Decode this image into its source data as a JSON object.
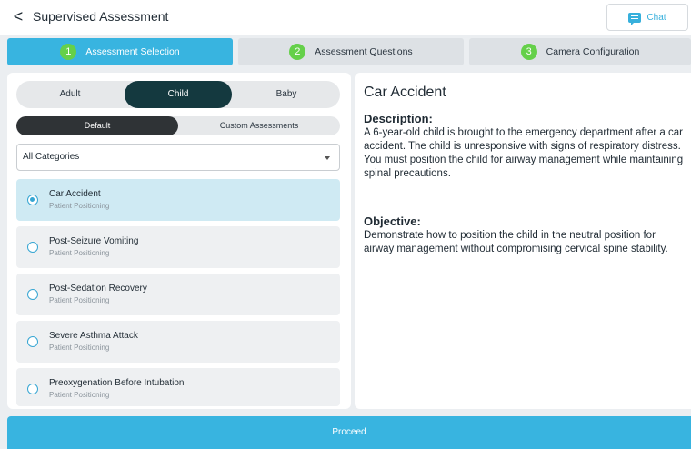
{
  "header": {
    "back_icon": "chevron-left-icon",
    "back_glyph": "<",
    "title": "Supervised Assessment",
    "chat_label": "Chat",
    "chat_icon": "chat-bubble-icon"
  },
  "steps": [
    {
      "number": "1",
      "label": "Assessment Selection",
      "active": true
    },
    {
      "number": "2",
      "label": "Assessment Questions",
      "active": false
    },
    {
      "number": "3",
      "label": "Camera Configuration",
      "active": false
    }
  ],
  "age_groups": [
    {
      "label": "Adult",
      "selected": false
    },
    {
      "label": "Child",
      "selected": true
    },
    {
      "label": "Baby",
      "selected": false
    }
  ],
  "assessment_types": [
    {
      "label": "Default",
      "selected": true
    },
    {
      "label": "Custom Assessments",
      "selected": false
    }
  ],
  "category_select": {
    "value": "All Categories"
  },
  "assessments": [
    {
      "title": "Car Accident",
      "subtitle": "Patient Positioning",
      "selected": true
    },
    {
      "title": "Post-Seizure Vomiting",
      "subtitle": "Patient Positioning",
      "selected": false
    },
    {
      "title": "Post-Sedation Recovery",
      "subtitle": "Patient Positioning",
      "selected": false
    },
    {
      "title": "Severe Asthma Attack",
      "subtitle": "Patient Positioning",
      "selected": false
    },
    {
      "title": "Preoxygenation Before Intubation",
      "subtitle": "Patient Positioning",
      "selected": false
    }
  ],
  "detail": {
    "title": "Car Accident",
    "description_heading": "Description:",
    "description": "A 6-year-old child is brought to the emergency department after a car accident. The child is unresponsive with signs of respiratory distress. You must position the child for airway management while maintaining spinal precautions.",
    "objective_heading": "Objective:",
    "objective": "Demonstrate how to position the child in the neutral position for airway management without compromising cervical spine stability."
  },
  "proceed_label": "Proceed",
  "colors": {
    "accent": "#38b4e0",
    "step_number": "#65d04a",
    "selected_segment": "#14393f",
    "selected_item": "#cfeaf3"
  }
}
